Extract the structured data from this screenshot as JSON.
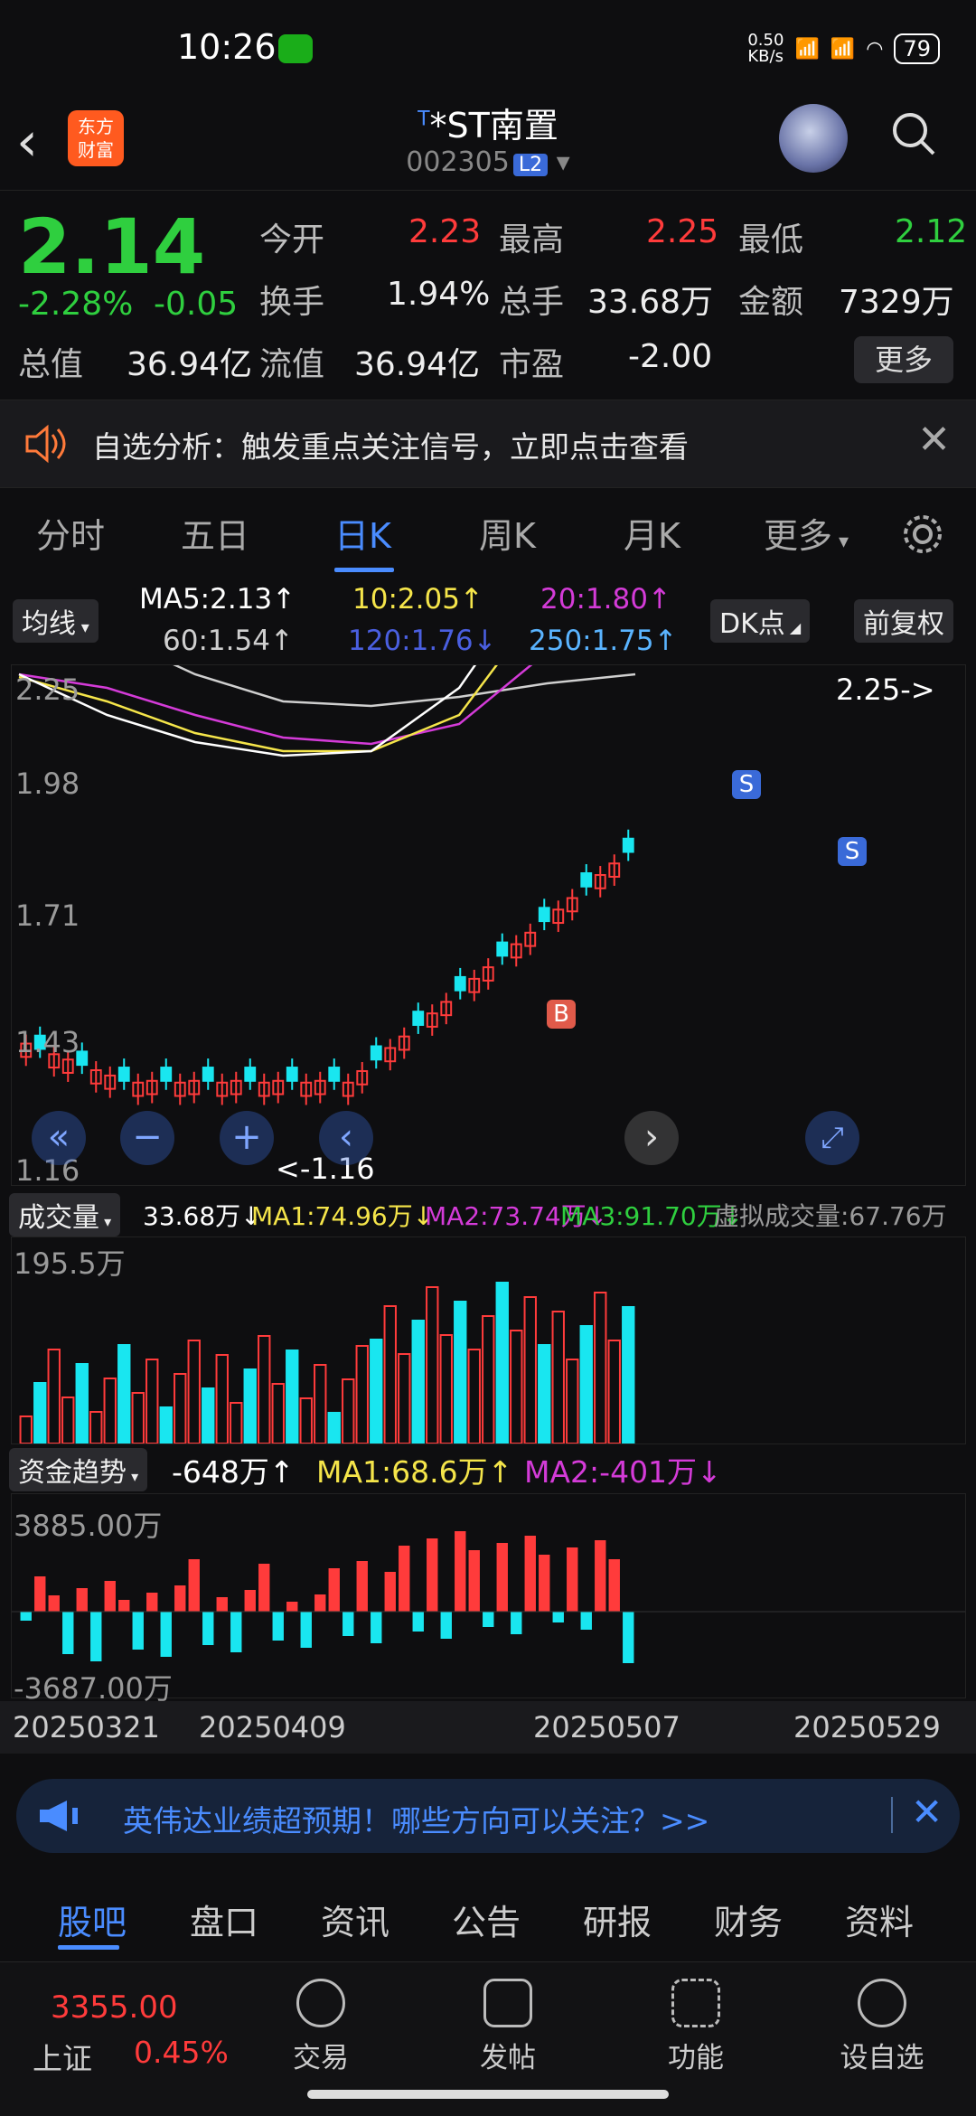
{
  "status": {
    "time": "10:26",
    "net": "0.50\nKB/s",
    "signal1": "HD",
    "signal2": "HD",
    "battery": "79"
  },
  "header": {
    "logo": "东方\n财富",
    "prefix": "T",
    "name": "*ST南置",
    "code": "002305",
    "level": "L2"
  },
  "quote": {
    "price": "2.14",
    "pct": "-2.28%",
    "chg": "-0.05",
    "items": [
      {
        "label": "今开",
        "value": "2.23",
        "color": "red"
      },
      {
        "label": "最高",
        "value": "2.25",
        "color": "red"
      },
      {
        "label": "最低",
        "value": "2.12",
        "color": "green"
      },
      {
        "label": "换手",
        "value": "1.94%",
        "color": "white"
      },
      {
        "label": "总手",
        "value": "33.68万",
        "color": "white"
      },
      {
        "label": "金额",
        "value": "7329万",
        "color": "white"
      },
      {
        "label": "总值",
        "value": "36.94亿",
        "color": "white"
      },
      {
        "label": "流值",
        "value": "36.94亿",
        "color": "white"
      },
      {
        "label": "市盈",
        "value": "-2.00",
        "color": "white"
      }
    ],
    "more": "更多"
  },
  "notice": {
    "text": "自选分析：触发重点关注信号，立即点击查看"
  },
  "tabs": [
    "分时",
    "五日",
    "日K",
    "周K",
    "月K",
    "更多"
  ],
  "ma": {
    "toggle": "均线",
    "ma5": "MA5:2.13↑",
    "ma10": "10:2.05↑",
    "ma20": "20:1.80↑",
    "ma60": "60:1.54↑",
    "ma120": "120:1.76↓",
    "ma250": "250:1.75↑",
    "dk": "DK点",
    "fq": "前复权"
  },
  "colors": {
    "up": "#ff3b3b",
    "down": "#19e6f0",
    "ma5": "#ffffff",
    "ma10": "#f5e54a",
    "ma20": "#d43bd8",
    "ma60": "#cfcfcf",
    "ma120": "#4a5fe0",
    "ma250": "#5ab4ff"
  },
  "kline": {
    "ymax": "2.25",
    "y2": "1.98",
    "y3": "1.71",
    "y4": "1.43",
    "ymin": "1.16",
    "high_label": "2.25->",
    "low_label": "<-1.16",
    "buy": "B",
    "sell": "S"
  },
  "volume": {
    "toggle": "成交量",
    "v": "33.68万↓",
    "ma1": "MA1:74.96万↓",
    "ma2": "MA2:73.74万↓",
    "ma3": "MA3:91.70万↓",
    "virtual": "虚拟成交量:67.76万",
    "ymax": "195.5万"
  },
  "fund": {
    "toggle": "资金趋势",
    "v": "-648万↑",
    "ma1": "MA1:68.6万↑",
    "ma2": "MA2:-401万↓",
    "ymax": "3885.00万",
    "ymin": "-3687.00万"
  },
  "dates": [
    "20250321",
    "20250409",
    "20250507",
    "20250529"
  ],
  "news": {
    "text": "英伟达业绩超预期！哪些方向可以关注？>>"
  },
  "btabs": [
    "股吧",
    "盘口",
    "资讯",
    "公告",
    "研报",
    "财务",
    "资料"
  ],
  "nav": {
    "index_value": "3355.00",
    "index_name": "上证",
    "index_pct": "0.45%",
    "items": [
      "交易",
      "发帖",
      "功能",
      "设自选"
    ]
  }
}
